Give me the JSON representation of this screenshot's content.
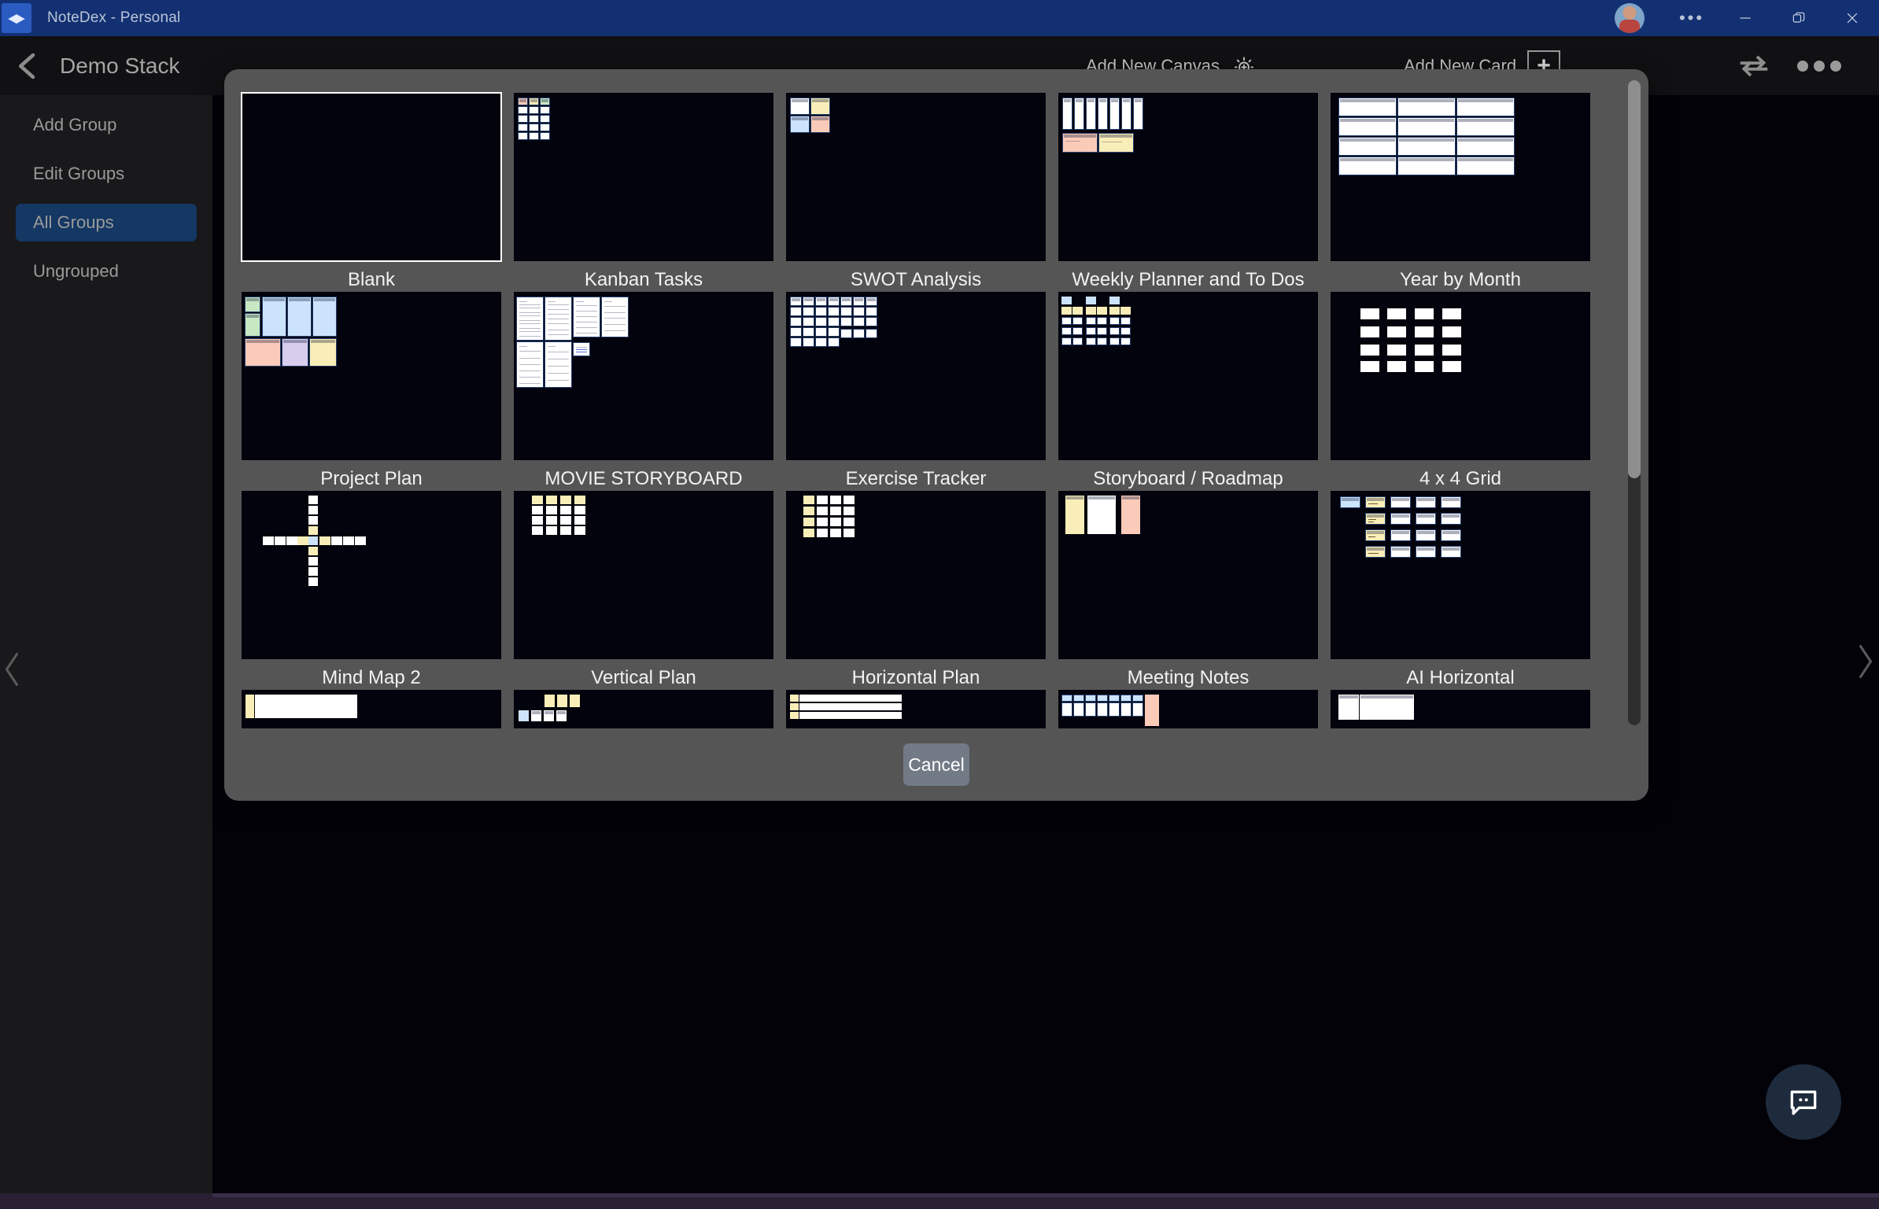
{
  "window": {
    "app_title": "NoteDex - Personal",
    "logo_icon": "notedex-logo-icon",
    "avatar_icon": "user-avatar",
    "more_icon": "window-more-icon",
    "minimize_icon": "minimize-icon",
    "restore_icon": "restore-icon",
    "close_icon": "close-icon"
  },
  "header": {
    "back_icon": "back-chevron-icon",
    "stack_title": "Demo Stack",
    "add_canvas_label": "Add New Canvas",
    "add_canvas_icon": "brightness-sun-icon",
    "add_card_label": "Add New Card",
    "add_card_icon": "plus-icon",
    "sync_icon": "sync-refresh-icon",
    "overflow_icon": "overflow-menu-icon"
  },
  "sidebar": {
    "items": [
      {
        "label": "Add Group",
        "active": false
      },
      {
        "label": "Edit Groups",
        "active": false
      },
      {
        "label": "All Groups",
        "active": true
      },
      {
        "label": "Ungrouped",
        "active": false
      }
    ]
  },
  "modal": {
    "cancel_label": "Cancel",
    "scrollbar": "vertical-scrollbar",
    "templates": [
      {
        "name": "Blank",
        "selected": true
      },
      {
        "name": "Kanban Tasks",
        "selected": false
      },
      {
        "name": "SWOT Analysis",
        "selected": false
      },
      {
        "name": "Weekly Planner and To Dos",
        "selected": false
      },
      {
        "name": "Year by Month",
        "selected": false
      },
      {
        "name": "Project Plan",
        "selected": false
      },
      {
        "name": "MOVIE STORYBOARD",
        "selected": false
      },
      {
        "name": "Exercise Tracker",
        "selected": false
      },
      {
        "name": "Storyboard / Roadmap",
        "selected": false
      },
      {
        "name": "4 x 4 Grid",
        "selected": false
      },
      {
        "name": "Mind Map 2",
        "selected": false
      },
      {
        "name": "Vertical Plan",
        "selected": false
      },
      {
        "name": "Horizontal Plan",
        "selected": false
      },
      {
        "name": "Meeting Notes",
        "selected": false
      },
      {
        "name": "AI Horizontal",
        "selected": false
      },
      {
        "name": "",
        "selected": false
      },
      {
        "name": "",
        "selected": false
      },
      {
        "name": "",
        "selected": false
      },
      {
        "name": "",
        "selected": false
      },
      {
        "name": "",
        "selected": false
      }
    ]
  },
  "canvas": {
    "collapse_left_icon": "collapse-left-chevron-icon",
    "collapse_right_icon": "collapse-right-chevron-icon",
    "chat_icon": "chat-bubble-icon"
  },
  "colors": {
    "titlebar": "#133072",
    "accent_active": "#143763",
    "modal_bg": "#555555",
    "canvas_bg": "#020208",
    "card_yellow": "#faeeb8",
    "card_pink": "#fbcbb9",
    "card_green": "#c7e8c3",
    "card_blue": "#cbe4fb",
    "card_purple": "#d9cdee"
  }
}
